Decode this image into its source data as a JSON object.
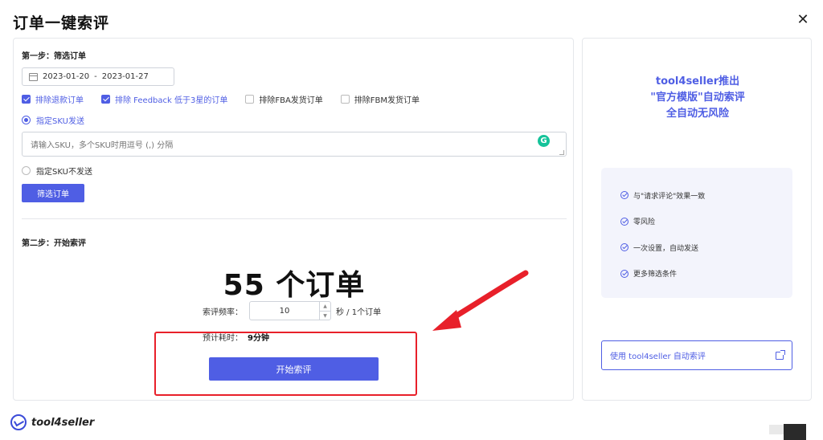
{
  "dialog": {
    "title": "订单一键索评",
    "close_glyph": "✕"
  },
  "step1": {
    "label": "第一步：筛选订单",
    "date_start": "2023-01-20",
    "date_sep": "-",
    "date_end": "2023-01-27",
    "checkboxes": [
      {
        "label": "排除退款订单",
        "checked": true
      },
      {
        "label": "排除 Feedback 低于3星的订单",
        "checked": true
      },
      {
        "label": "排除FBA发货订单",
        "checked": false
      },
      {
        "label": "排除FBM发货订单",
        "checked": false
      }
    ],
    "radio_send": "指定SKU发送",
    "sku_placeholder": "请输入SKU，多个SKU时用逗号 (,) 分隔",
    "radio_nosend": "指定SKU不发送",
    "filter_button": "筛选订单"
  },
  "step2": {
    "label": "第二步：开始索评",
    "order_count": "55 个订单",
    "freq_label": "索评频率：",
    "freq_value": "10",
    "freq_unit": "秒 / 1个订单",
    "time_label": "预计耗时：",
    "time_value": "9分钟",
    "start_button": "开始索评"
  },
  "promo": {
    "lines": [
      "tool4seller推出",
      "\"官方模版\"自动索评",
      "全自动无风险"
    ],
    "features": [
      "与\"请求评论\"效果一致",
      "零风险",
      "一次设置，自动发送",
      "更多筛选条件"
    ],
    "use_button": "使用 tool4seller 自动索评"
  },
  "footer": {
    "brand": "tool4seller"
  },
  "colors": {
    "accent": "#4f5ee4",
    "annotation": "#e8202a"
  }
}
